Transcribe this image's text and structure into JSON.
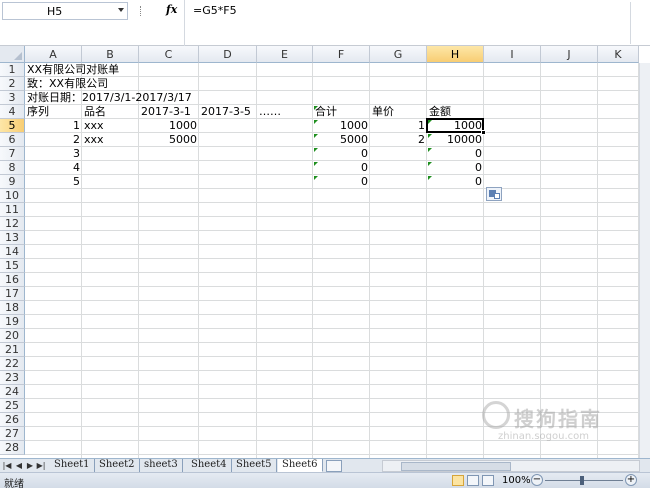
{
  "formula_bar": {
    "name_box": "H5",
    "fx_label": "fx",
    "formula": "=G5*F5"
  },
  "grid": {
    "columns": [
      "A",
      "B",
      "C",
      "D",
      "E",
      "F",
      "G",
      "H",
      "I",
      "J",
      "K"
    ],
    "selected_column": "H",
    "rows": [
      "1",
      "2",
      "3",
      "4",
      "5",
      "6",
      "7",
      "8",
      "9",
      "10",
      "11",
      "12",
      "13",
      "14",
      "15",
      "16",
      "17",
      "18",
      "19",
      "20",
      "21",
      "22",
      "23",
      "24",
      "25",
      "26",
      "27",
      "28"
    ],
    "selected_row": "5",
    "cells": {
      "A1": "XX有限公司对账单",
      "A2": "致：XX有限公司",
      "A3": "对账日期：2017/3/1-2017/3/17",
      "A4": "序列",
      "B4": "品名",
      "C4": "2017-3-1",
      "D4": "2017-3-5",
      "E4": "……",
      "F4": "合计",
      "G4": "单价",
      "H4": "金额",
      "A5": "1",
      "B5": "xxx",
      "C5": "1000",
      "F5": "1000",
      "G5": "1",
      "H5": "1000",
      "A6": "2",
      "B6": "xxx",
      "C6": "5000",
      "F6": "5000",
      "G6": "2",
      "H6": "10000",
      "A7": "3",
      "F7": "0",
      "H7": "0",
      "A8": "4",
      "F8": "0",
      "H8": "0",
      "A9": "5",
      "F9": "0",
      "H9": "0"
    }
  },
  "sheet_tabs": [
    "Sheet1",
    "Sheet2",
    "sheet3",
    "Sheet4",
    "Sheet5",
    "Sheet6"
  ],
  "active_tab": "Sheet6",
  "status_bar": {
    "ready": "就绪",
    "zoom": "100%",
    "zoom_minus": "−",
    "zoom_plus": "+"
  },
  "watermark": {
    "text": "搜狗指南",
    "url": "zhinan.sogou.com"
  },
  "colors": {
    "header_selected": "#f8cd73",
    "green_triangle": "#1f8f1f",
    "grid_line": "#dadcdd"
  }
}
